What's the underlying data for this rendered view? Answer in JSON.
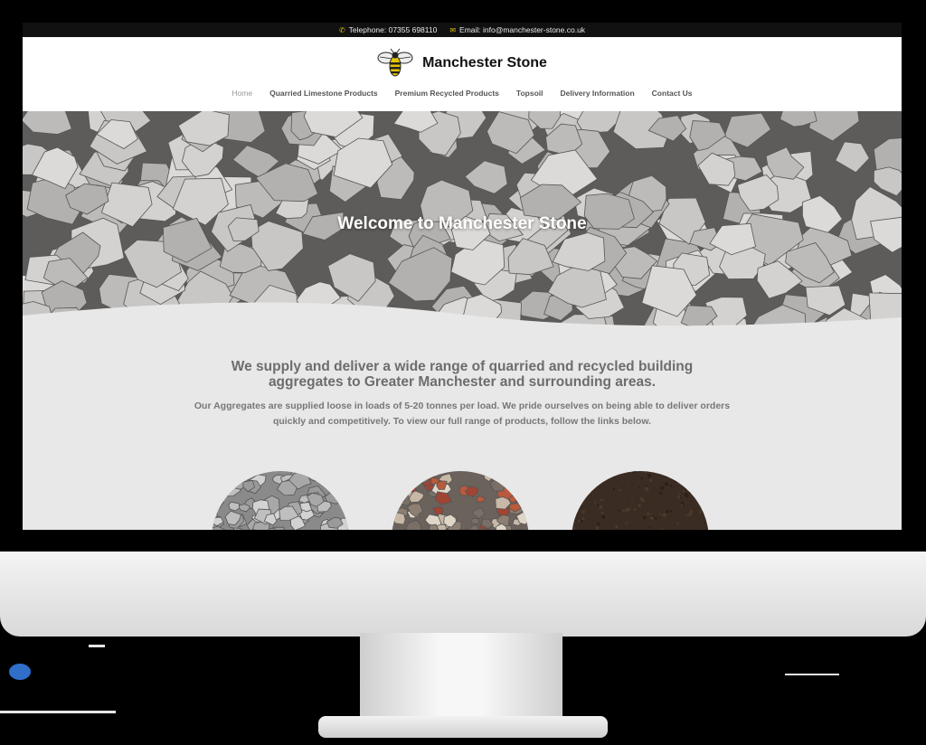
{
  "topbar": {
    "phone_icon": "phone-icon",
    "phone": "Telephone: 07355 698110",
    "email_icon": "email-icon",
    "email": "Email: info@manchester-stone.co.uk"
  },
  "brand": {
    "logo_icon": "bee-icon",
    "name": "Manchester Stone"
  },
  "nav": {
    "items": [
      "Home",
      "Quarried Limestone Products",
      "Premium Recycled Products",
      "Topsoil",
      "Delivery Information",
      "Contact Us"
    ],
    "active": "Home"
  },
  "hero": {
    "title": "Welcome to Manchester Stone"
  },
  "intro": {
    "lead": "We supply and deliver a wide range of quarried and recycled building aggregates to Greater Manchester and surrounding areas.",
    "body": "Our Aggregates are supplied loose in loads of 5-20 tonnes per load. We pride ourselves on being able to deliver orders quickly and competitively. To view our full range of products, follow the links below."
  },
  "products": {
    "items": [
      "limestone",
      "recycled",
      "topsoil"
    ]
  },
  "colors": {
    "accent": "#e3c400",
    "topbar_bg": "#111111",
    "content_bg": "#e8e8e8",
    "text_grey": "#6d6d6d"
  }
}
